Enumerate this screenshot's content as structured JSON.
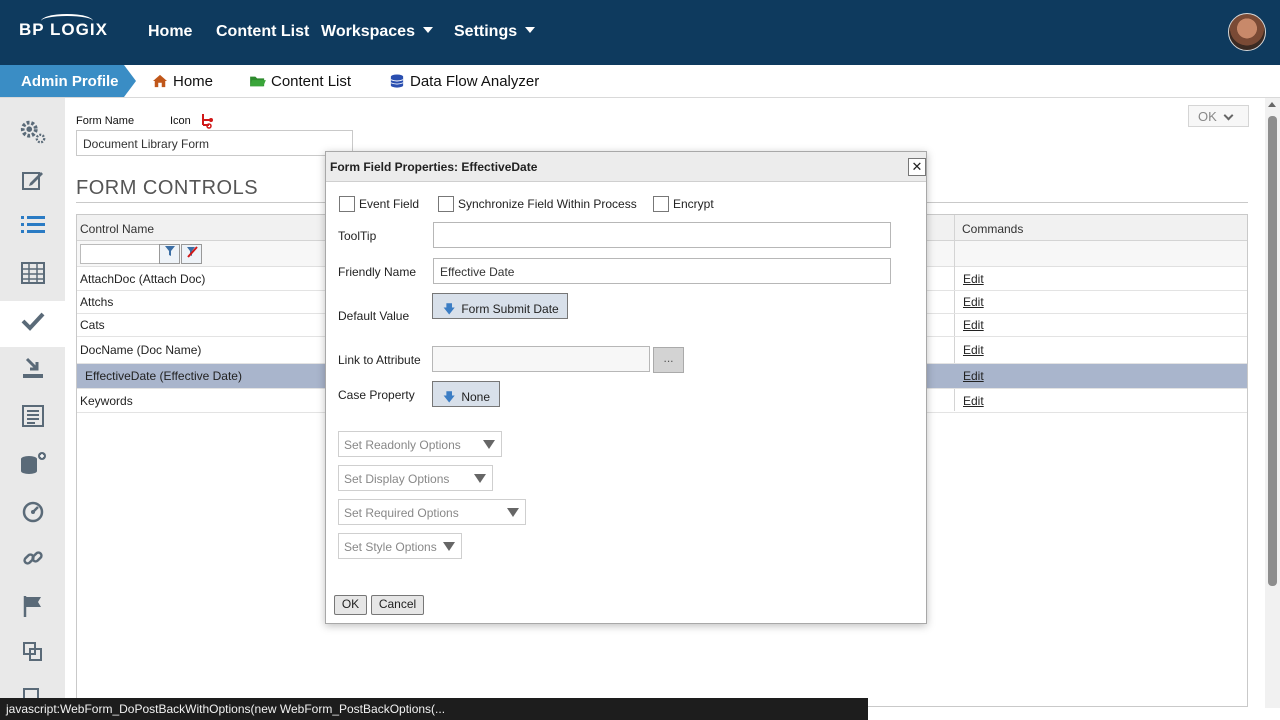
{
  "topbar": {
    "logo": "BP LOGIX",
    "nav": [
      {
        "label": "Home"
      },
      {
        "label": "Content List"
      },
      {
        "label": "Workspaces"
      },
      {
        "label": "Settings"
      }
    ]
  },
  "subbar": {
    "admin_tab": "Admin Profile",
    "links": [
      {
        "label": "Home",
        "icon": "home-icon"
      },
      {
        "label": "Content List",
        "icon": "folder-icon"
      },
      {
        "label": "Data Flow Analyzer",
        "icon": "database-icon"
      }
    ]
  },
  "sidebar": {
    "icons": [
      "gears-icon",
      "edit-icon",
      "list-icon",
      "table-icon",
      "check-icon",
      "download-icon",
      "form-list-icon",
      "database-add-icon",
      "dashboard-icon",
      "link-icon",
      "flag-icon",
      "copy-icon",
      "more-icon"
    ],
    "active_index": 2
  },
  "form": {
    "form_name_label": "Form Name",
    "icon_label": "Icon",
    "form_name_value": "Document Library Form",
    "ok_button": "OK",
    "section_title": "FORM CONTROLS",
    "table": {
      "col_control_name": "Control Name",
      "col_commands": "Commands",
      "rows": [
        {
          "name": "AttachDoc (Attach Doc)",
          "command": "Edit"
        },
        {
          "name": "Attchs",
          "command": "Edit"
        },
        {
          "name": "Cats",
          "command": "Edit"
        },
        {
          "name": "DocName (Doc Name)",
          "command": "Edit"
        },
        {
          "name": "EffectiveDate (Effective Date)",
          "command": "Edit",
          "selected": true
        },
        {
          "name": "Keywords",
          "command": "Edit"
        }
      ]
    }
  },
  "modal": {
    "title": "Form Field Properties: EffectiveDate",
    "close": "✕",
    "event_field": "Event Field",
    "synchronize": "Synchronize Field Within Process",
    "encrypt": "Encrypt",
    "tooltip_label": "ToolTip",
    "tooltip_value": "",
    "friendly_name_label": "Friendly Name",
    "friendly_name_value": "Effective Date",
    "default_value_label": "Default Value",
    "default_value_button": "Form Submit Date",
    "link_attr_label": "Link to Attribute",
    "link_attr_value": "",
    "link_attr_button": "...",
    "case_property_label": "Case Property",
    "case_property_button": "None",
    "readonly_options": "Set Readonly Options",
    "display_options": "Set Display Options",
    "required_options": "Set Required Options",
    "style_options": "Set Style Options",
    "ok": "OK",
    "cancel": "Cancel"
  },
  "status_text": "javascript:WebForm_DoPostBackWithOptions(new WebForm_PostBackOptions(..."
}
